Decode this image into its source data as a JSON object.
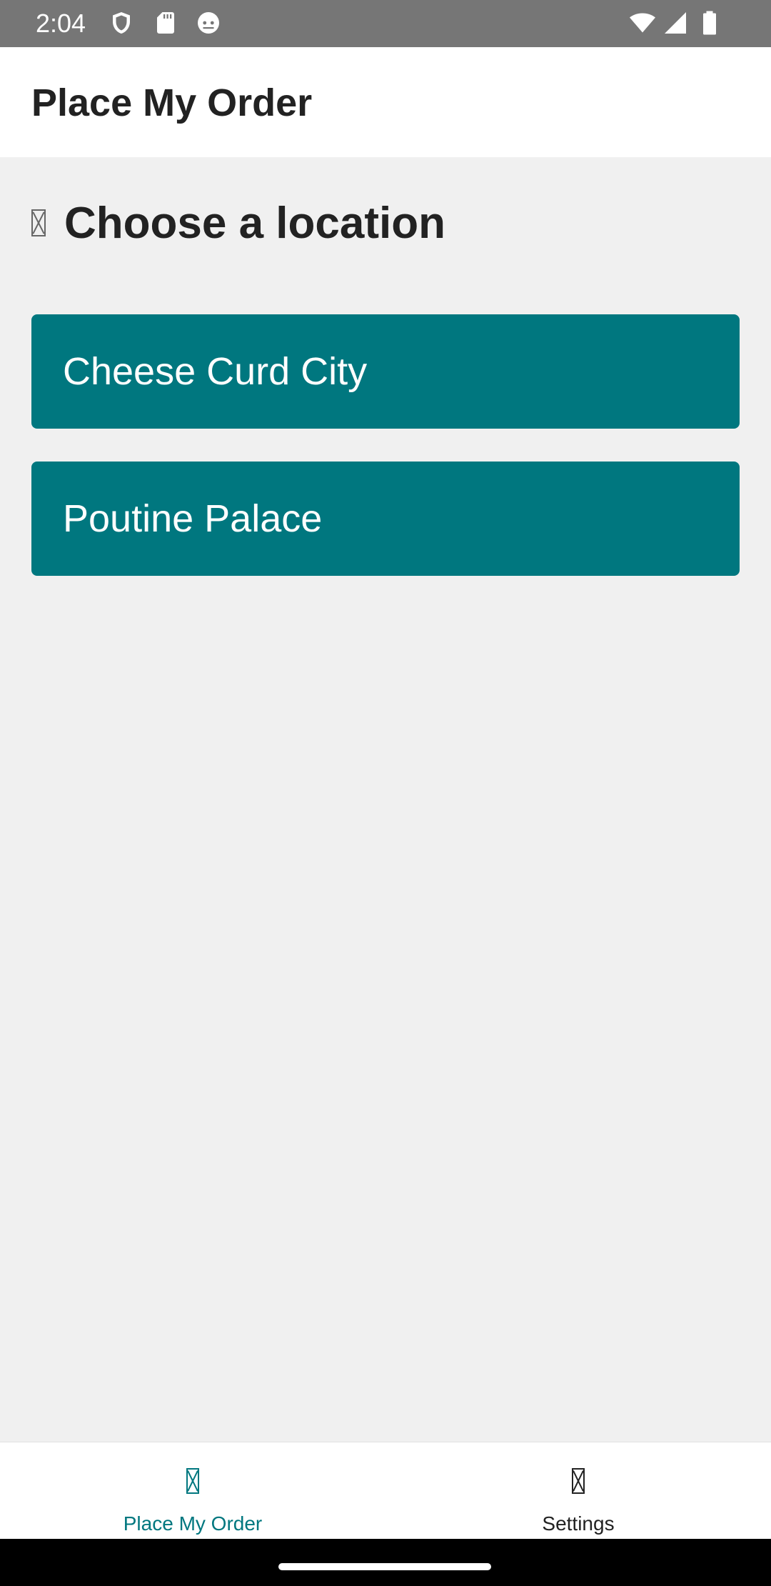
{
  "status_bar": {
    "time": "2:04",
    "left_icons": [
      "shield-icon",
      "sd-card-icon",
      "android-debug-icon"
    ],
    "right_icons": [
      "wifi-icon",
      "cellular-signal-icon",
      "battery-icon"
    ]
  },
  "app_bar": {
    "title": "Place My Order"
  },
  "main": {
    "heading": {
      "icon": "missing-glyph-icon",
      "text": "Choose a location"
    },
    "locations": [
      {
        "label": "Cheese Curd City"
      },
      {
        "label": "Poutine Palace"
      }
    ]
  },
  "bottom_nav": {
    "items": [
      {
        "label": "Place My Order",
        "icon": "missing-glyph-icon",
        "active": true
      },
      {
        "label": "Settings",
        "icon": "missing-glyph-icon",
        "active": false
      }
    ]
  },
  "colors": {
    "accent": "#00777f",
    "background": "#f0f0f0",
    "status_bar": "#767676"
  }
}
